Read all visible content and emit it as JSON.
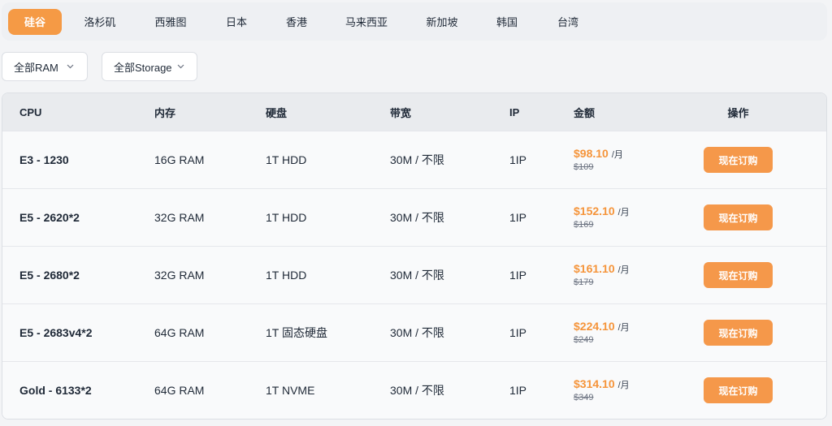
{
  "regions": [
    {
      "label": "硅谷",
      "active": true
    },
    {
      "label": "洛杉矶",
      "active": false
    },
    {
      "label": "西雅图",
      "active": false
    },
    {
      "label": "日本",
      "active": false
    },
    {
      "label": "香港",
      "active": false
    },
    {
      "label": "马来西亚",
      "active": false
    },
    {
      "label": "新加坡",
      "active": false
    },
    {
      "label": "韩国",
      "active": false
    },
    {
      "label": "台湾",
      "active": false
    }
  ],
  "filters": {
    "ram": "全部RAM",
    "storage": "全部Storage"
  },
  "table": {
    "headers": {
      "cpu": "CPU",
      "ram": "内存",
      "disk": "硬盘",
      "bandwidth": "带宽",
      "ip": "IP",
      "price": "金额",
      "action": "操作"
    },
    "rows": [
      {
        "cpu": "E3 - 1230",
        "ram": "16G RAM",
        "disk": "1T HDD",
        "bandwidth": "30M / 不限",
        "ip": "1IP",
        "price": "$98.10",
        "unit": "/月",
        "old_price": "$109",
        "button": "现在订购"
      },
      {
        "cpu": "E5 - 2620*2",
        "ram": "32G RAM",
        "disk": "1T HDD",
        "bandwidth": "30M / 不限",
        "ip": "1IP",
        "price": "$152.10",
        "unit": "/月",
        "old_price": "$169",
        "button": "现在订购"
      },
      {
        "cpu": "E5 - 2680*2",
        "ram": "32G RAM",
        "disk": "1T HDD",
        "bandwidth": "30M / 不限",
        "ip": "1IP",
        "price": "$161.10",
        "unit": "/月",
        "old_price": "$179",
        "button": "现在订购"
      },
      {
        "cpu": "E5 - 2683v4*2",
        "ram": "64G RAM",
        "disk": "1T 固态硬盘",
        "bandwidth": "30M / 不限",
        "ip": "1IP",
        "price": "$224.10",
        "unit": "/月",
        "old_price": "$249",
        "button": "现在订购"
      },
      {
        "cpu": "Gold - 6133*2",
        "ram": "64G RAM",
        "disk": "1T NVME",
        "bandwidth": "30M / 不限",
        "ip": "1IP",
        "price": "$314.10",
        "unit": "/月",
        "old_price": "$349",
        "button": "现在订购"
      }
    ]
  },
  "colors": {
    "accent": "#f59a45",
    "price": "#f5943a"
  },
  "icons": {
    "filter_chevron": "chevron-down-icon"
  }
}
